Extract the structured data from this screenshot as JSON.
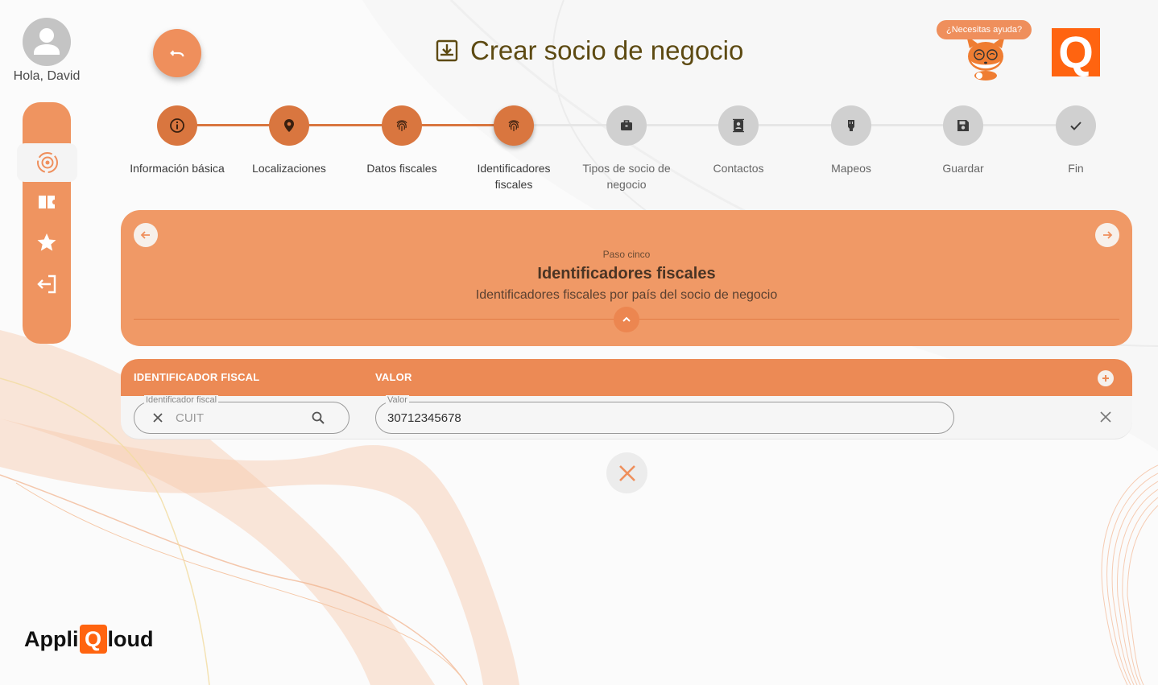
{
  "user": {
    "greeting": "Hola, David"
  },
  "nav": {
    "items": [
      {
        "icon": "settings-sync-icon",
        "active": true
      },
      {
        "icon": "tickets-icon",
        "active": false
      },
      {
        "icon": "star-icon",
        "active": false
      },
      {
        "icon": "logout-icon",
        "active": false
      }
    ]
  },
  "header": {
    "title": "Crear socio de negocio",
    "help_label": "¿Necesitas ayuda?",
    "logo_letter": "Q"
  },
  "stepper": {
    "steps": [
      {
        "label": "Información básica",
        "icon": "info-icon",
        "state": "done"
      },
      {
        "label": "Localizaciones",
        "icon": "location-pin-icon",
        "state": "done"
      },
      {
        "label": "Datos fiscales",
        "icon": "fingerprint-icon",
        "state": "done"
      },
      {
        "label": "Identificadores fiscales",
        "icon": "fingerprint-icon",
        "state": "current"
      },
      {
        "label": "Tipos de socio de negocio",
        "icon": "briefcase-icon",
        "state": "todo"
      },
      {
        "label": "Contactos",
        "icon": "contacts-icon",
        "state": "todo"
      },
      {
        "label": "Mapeos",
        "icon": "mapping-icon",
        "state": "todo"
      },
      {
        "label": "Guardar",
        "icon": "save-icon",
        "state": "todo"
      },
      {
        "label": "Fin",
        "icon": "check-icon",
        "state": "todo"
      }
    ]
  },
  "info_card": {
    "kicker": "Paso cinco",
    "title": "Identificadores fiscales",
    "subtitle": "Identificadores fiscales por país del socio de negocio"
  },
  "table": {
    "columns": [
      "IDENTIFICADOR FISCAL",
      "VALOR"
    ],
    "rows": [
      {
        "identifier_label": "Identificador fiscal",
        "identifier_placeholder": "CUIT",
        "value_label": "Valor",
        "value": "30712345678"
      }
    ]
  },
  "brand": {
    "prefix": "Appli",
    "q": "Q",
    "suffix": "loud"
  },
  "colors": {
    "accent": "#ef8f5c",
    "accent_dark": "#d9763f",
    "card": "#f09966",
    "title": "#5d4a12",
    "inactive": "#d0d0d0",
    "logo": "#ff6410"
  }
}
